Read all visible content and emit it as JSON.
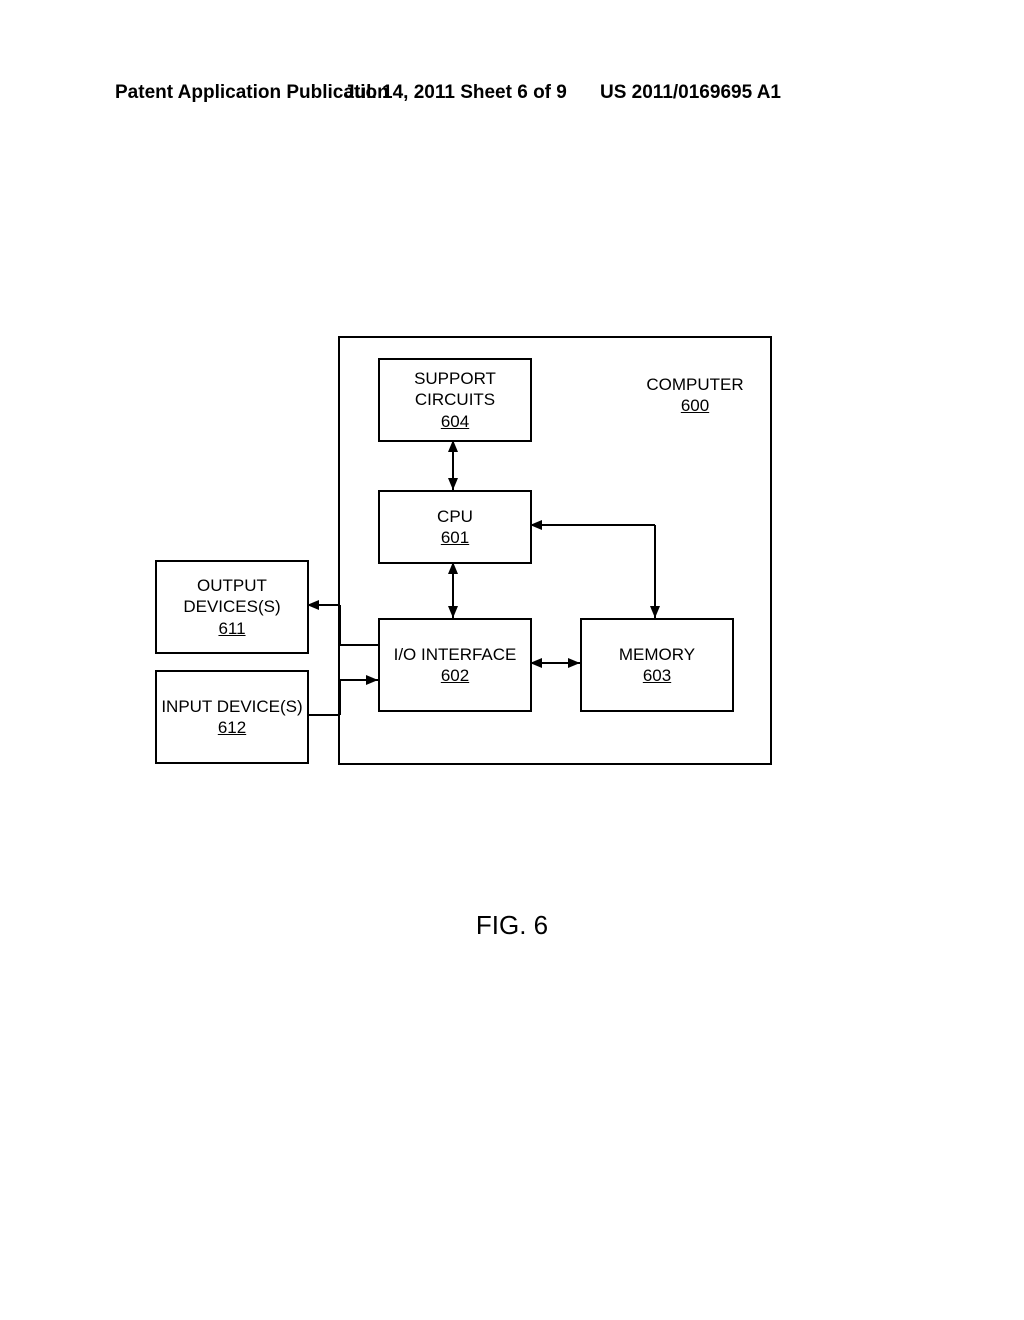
{
  "header": {
    "left": "Patent Application Publication",
    "center": "Jul. 14, 2011  Sheet 6 of 9",
    "right": "US 2011/0169695 A1"
  },
  "figure": {
    "caption": "FIG. 6"
  },
  "blocks": {
    "support_circuits": {
      "label": "SUPPORT CIRCUITS",
      "ref": "604"
    },
    "computer": {
      "label": "COMPUTER",
      "ref": "600"
    },
    "cpu": {
      "label": "CPU",
      "ref": "601"
    },
    "io_interface": {
      "label": "I/O INTERFACE",
      "ref": "602"
    },
    "memory": {
      "label": "MEMORY",
      "ref": "603"
    },
    "output_devices": {
      "label": "OUTPUT DEVICES(S)",
      "ref": "611"
    },
    "input_devices": {
      "label": "INPUT DEVICE(S)",
      "ref": "612"
    }
  }
}
